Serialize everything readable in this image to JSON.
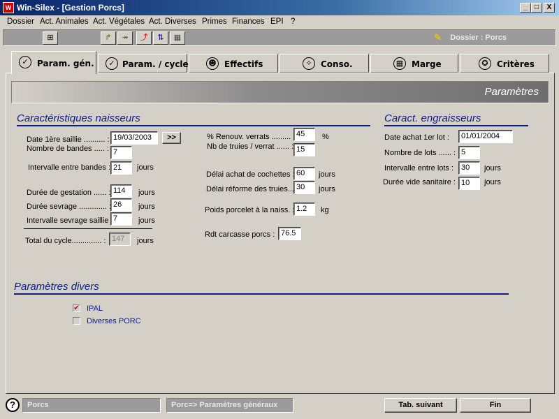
{
  "window": {
    "title": "Win-Silex - [Gestion Porcs]",
    "app_icon": "W",
    "controls": {
      "minimize": "_",
      "maximize": "□",
      "close": "X"
    }
  },
  "menu": [
    "Dossier",
    "Act. Animales",
    "Act. Végétales",
    "Act. Diverses",
    "Primes",
    "Finances",
    "EPI",
    "?"
  ],
  "toolbar": {
    "buttons": [
      {
        "icon": "tree-structure-icon",
        "glyph": "⊞"
      },
      {
        "icon": "arrow-forward-icon",
        "glyph": "↱"
      },
      {
        "icon": "double-arrow-icon",
        "glyph": "↠"
      },
      {
        "icon": "chart-line-icon",
        "glyph": "⤴"
      },
      {
        "icon": "sort-icon",
        "glyph": "⇅"
      },
      {
        "icon": "calculator-icon",
        "glyph": "▦"
      }
    ],
    "dossier_label": "Dossier : Porcs"
  },
  "tabs": [
    {
      "label": "Param. gén.",
      "icon": "checkmark-icon",
      "glyph": "✓",
      "active": true
    },
    {
      "label": "Param. / cycle",
      "icon": "checkmark-icon",
      "glyph": "✓",
      "active": false
    },
    {
      "label": "Effectifs",
      "icon": "people-icon",
      "glyph": "☻",
      "active": false
    },
    {
      "label": "Conso.",
      "icon": "compass-icon",
      "glyph": "✧",
      "active": false
    },
    {
      "label": "Marge",
      "icon": "calculator-icon",
      "glyph": "▦",
      "active": false
    },
    {
      "label": "Critères",
      "icon": "star-icon",
      "glyph": "✪",
      "active": false
    }
  ],
  "banner": "Paramètres",
  "naisseurs": {
    "title": "Caractéristiques naisseurs",
    "date_saillie_label": "Date 1ère saillie .......... :",
    "date_saillie": "19/03/2003",
    "date_btn": ">>",
    "nb_bandes_label": "Nombre de bandes ..... :",
    "nb_bandes": "7",
    "intervalle_bandes_label": "Intervalle entre bandes :",
    "intervalle_bandes": "21",
    "duree_gestation_label": "Durée de gestation ...... :",
    "duree_gestation": "114",
    "duree_sevrage_label": "Durée sevrage ............. :",
    "duree_sevrage": "26",
    "intervalle_sevrage_label": "Intervalle sevrage saillie :",
    "intervalle_sevrage": "7",
    "total_cycle_label": "Total du cycle.............. :",
    "total_cycle": "147",
    "renouv_verrats_label": "% Renouv. verrats ......... :",
    "renouv_verrats": "45",
    "percent": "%",
    "truies_verrat_label": "Nb de truies / verrat ...... :",
    "truies_verrat": "15",
    "delai_cochettes_label": "Délai achat de cochettes :",
    "delai_cochettes": "60",
    "delai_reforme_label": "Délai réforme des truies... :",
    "delai_reforme": "30",
    "poids_porcelet_label": "Poids porcelet à la naiss. :",
    "poids_porcelet": "1.2",
    "kg": "kg",
    "rdt_carcasse_label": "Rdt carcasse porcs :",
    "rdt_carcasse": "76.5",
    "jours": "jours"
  },
  "engraisseurs": {
    "title": "Caract. engraisseurs",
    "date_achat_label": "Date achat 1er lot  :",
    "date_achat": "01/01/2004",
    "nb_lots_label": "Nombre de lots ...... :",
    "nb_lots": "5",
    "intervalle_lots_label": "Intervalle entre lots :",
    "intervalle_lots": "30",
    "duree_vide_label": "Durée vide sanitaire :",
    "duree_vide": "10",
    "jours": "jours"
  },
  "divers": {
    "title": "Paramètres divers",
    "options": [
      {
        "label": "IPAL",
        "checked": true,
        "mark": "✔"
      },
      {
        "label": "Diverses PORC",
        "checked": false,
        "mark": ""
      }
    ]
  },
  "statusbar": {
    "help": "?",
    "module": "Porcs",
    "path": "Porc=> Paramètres généraux",
    "next_tab": "Tab. suivant",
    "end": "Fin"
  }
}
